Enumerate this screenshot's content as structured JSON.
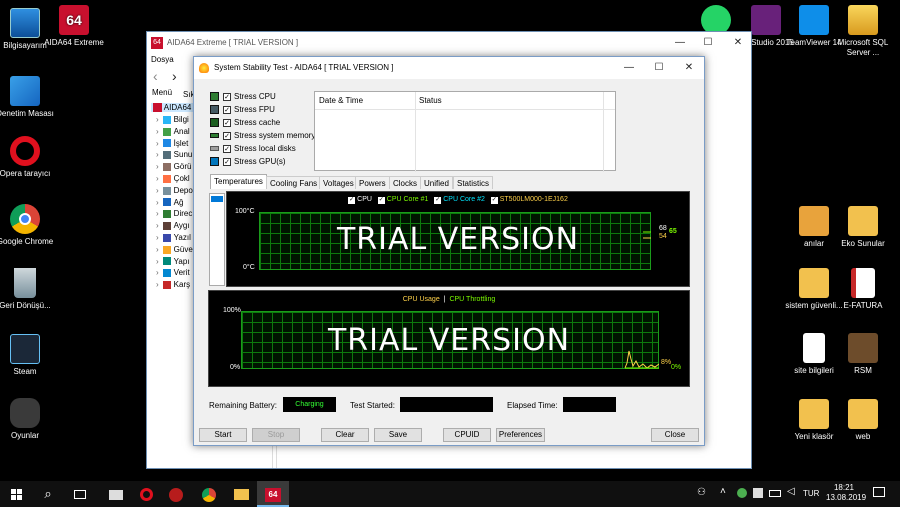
{
  "desktop": {
    "left_icons": [
      {
        "label": "Bilgisayarım",
        "icon": "computer-icon"
      },
      {
        "label": "Denetim Masası",
        "icon": "control-panel-icon"
      },
      {
        "label": "Opera tarayıcı",
        "icon": "opera-icon"
      },
      {
        "label": "Google Chrome",
        "icon": "chrome-icon"
      },
      {
        "label": "Geri Dönüşü...",
        "icon": "recycle-bin-icon"
      },
      {
        "label": "Steam",
        "icon": "steam-icon"
      },
      {
        "label": "Oyunlar",
        "icon": "games-icon"
      }
    ],
    "top_icons": [
      {
        "label": "AIDA64 Extreme",
        "icon": "aida64-icon"
      },
      {
        "label": "",
        "icon": "whatsapp-icon"
      },
      {
        "label": "ual Studio 2015",
        "icon": "visual-studio-icon"
      },
      {
        "label": "TeamViewer 14",
        "icon": "teamviewer-icon"
      },
      {
        "label": "Microsoft SQL Server ...",
        "icon": "sql-server-icon"
      }
    ],
    "right_icons": [
      {
        "label": "anılar",
        "icon": "folder-key-icon"
      },
      {
        "label": "Eko Sunular",
        "icon": "folder-icon"
      },
      {
        "label": "sistem güvenli...",
        "icon": "folder-icon"
      },
      {
        "label": "E-FATURA",
        "icon": "document-icon"
      },
      {
        "label": "site bilgileri",
        "icon": "text-file-icon"
      },
      {
        "label": "RSM",
        "icon": "folder-dark-icon"
      },
      {
        "label": "Yeni klasör",
        "icon": "folder-icon"
      },
      {
        "label": "web",
        "icon": "folder-icon"
      }
    ]
  },
  "main_window": {
    "title": "AIDA64 Extreme  [ TRIAL VERSION ]",
    "menu_item": "Dosya",
    "tabs": [
      "Menü",
      "Sık"
    ],
    "nav_root": "AIDA64",
    "nav_items": [
      "Bilgi",
      "Anal",
      "İşlet",
      "Sunu",
      "Görü",
      "Çokl",
      "Depo",
      "Ağ",
      "Direc",
      "Aygı",
      "Yazıl",
      "Güve",
      "Yapı",
      "Verit",
      "Karş"
    ]
  },
  "dialog": {
    "title": "System Stability Test - AIDA64  [ TRIAL VERSION ]",
    "stress_options": [
      {
        "label": "Stress CPU",
        "checked": true
      },
      {
        "label": "Stress FPU",
        "checked": true
      },
      {
        "label": "Stress cache",
        "checked": true
      },
      {
        "label": "Stress system memory",
        "checked": true
      },
      {
        "label": "Stress local disks",
        "checked": true
      },
      {
        "label": "Stress GPU(s)",
        "checked": true
      }
    ],
    "log_table": {
      "columns": [
        "Date & Time",
        "Status"
      ],
      "rows": []
    },
    "tabs": [
      "Temperatures",
      "Cooling Fans",
      "Voltages",
      "Powers",
      "Clocks",
      "Unified",
      "Statistics"
    ],
    "active_tab": "Temperatures",
    "temp_chart": {
      "legend": [
        {
          "label": "CPU",
          "color": "#ffffff"
        },
        {
          "label": "CPU Core #1",
          "color": "#7cfc00"
        },
        {
          "label": "CPU Core #2",
          "color": "#00e5ff"
        },
        {
          "label": "ST500LM000-1EJ162",
          "color": "#ffd24a"
        }
      ],
      "y_max_label": "100°C",
      "y_min_label": "0°C",
      "watermark": "TRIAL VERSION",
      "current_values": [
        "68",
        "65",
        "54"
      ]
    },
    "cpu_chart": {
      "legend": [
        {
          "label": "CPU Usage",
          "color": "#ffd24a"
        },
        {
          "label": "CPU Throttling",
          "color": "#7cfc00"
        }
      ],
      "legend_sep": "|",
      "y_max_label": "100%",
      "y_min_label": "0%",
      "watermark": "TRIAL VERSION",
      "current_values": [
        "8%",
        "0%"
      ]
    },
    "status": {
      "battery_label": "Remaining Battery:",
      "battery_value": "Charging",
      "test_started_label": "Test Started:",
      "test_started_value": "",
      "elapsed_label": "Elapsed Time:",
      "elapsed_value": ""
    },
    "buttons": {
      "start": "Start",
      "stop": "Stop",
      "clear": "Clear",
      "save": "Save",
      "cpuid": "CPUID",
      "preferences": "Preferences",
      "close": "Close"
    }
  },
  "taskbar": {
    "tray_lang": "TUR",
    "time": "18:21",
    "date": "13.08.2019"
  },
  "colors": {
    "accent": "#0078d7",
    "chart_grid": "#0d7a0d",
    "aida_red": "#c8102e"
  }
}
